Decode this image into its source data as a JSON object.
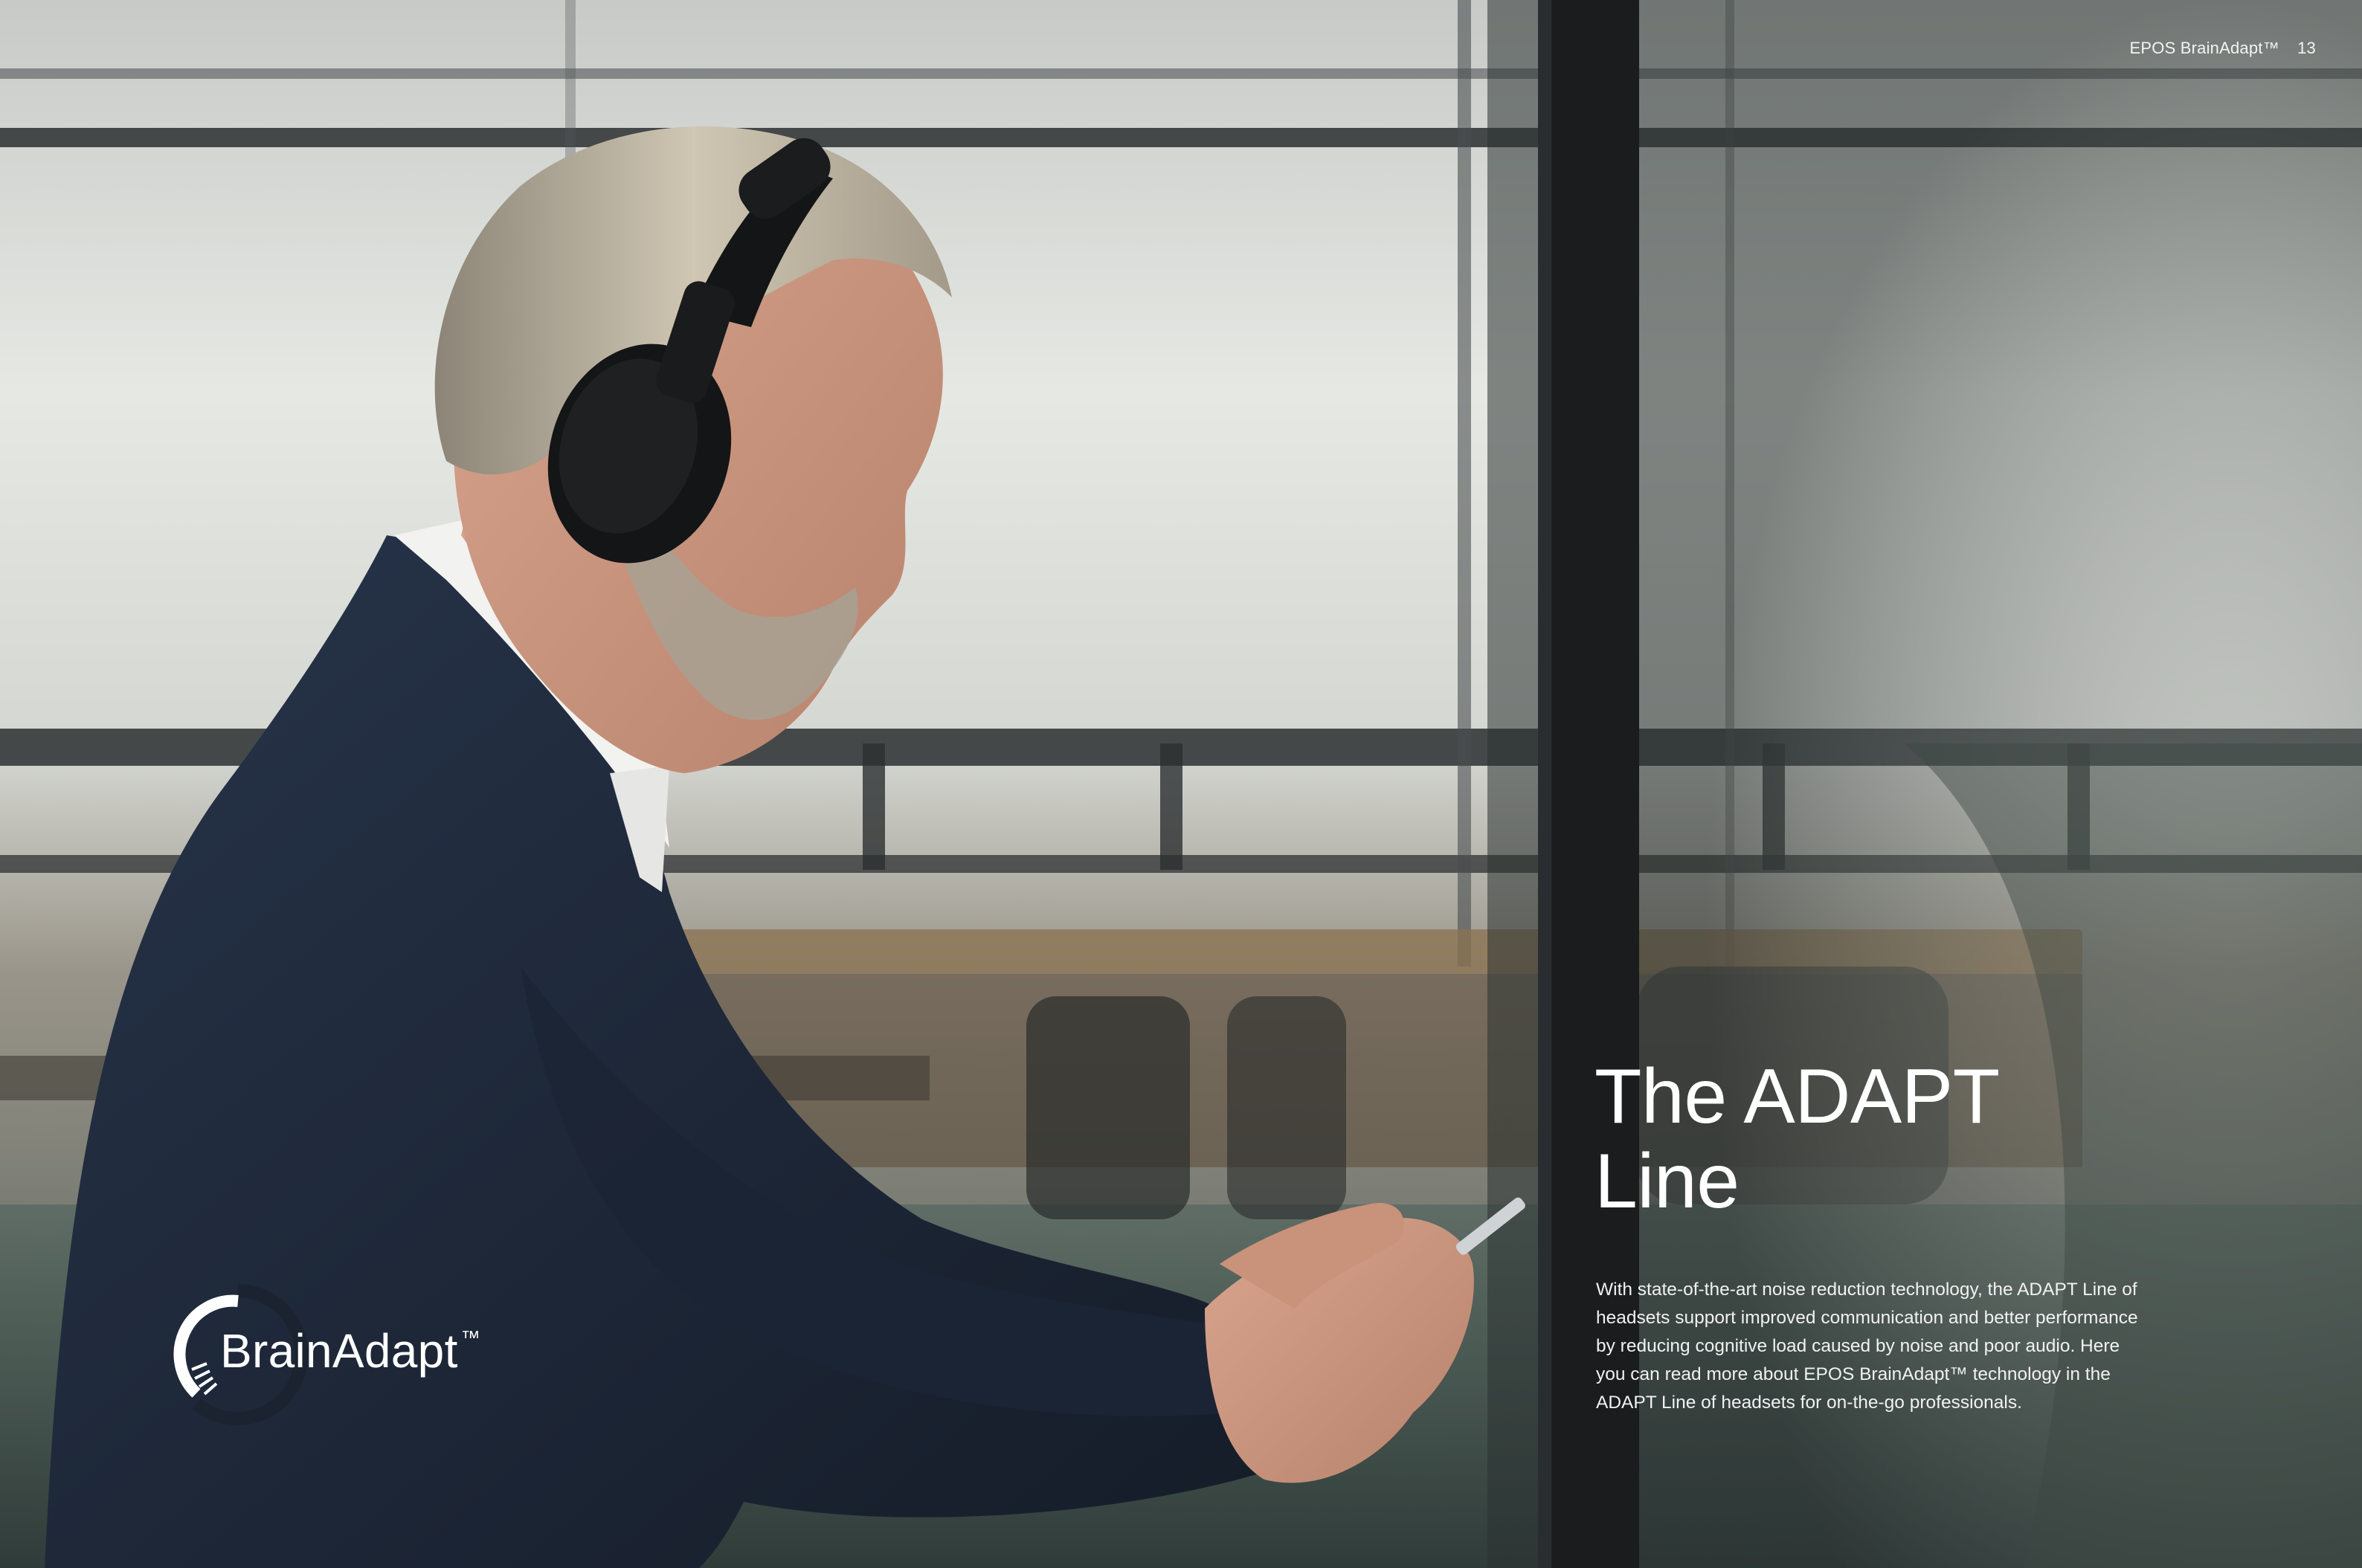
{
  "header": {
    "running_title": "EPOS BrainAdapt™",
    "page_number": "13"
  },
  "main": {
    "headline_line1": "The ADAPT",
    "headline_line2": "Line",
    "body": "With state-of-the-art noise reduction technology, the ADAPT Line of headsets support improved communication and better performance by reducing cognitive load caused by noise and poor audio. Here you can read more about EPOS BrainAdapt™ technology in the ADAPT Line of headsets for on-the-go professionals."
  },
  "logo": {
    "wordmark": "BrainAdapt",
    "trademark": "™"
  },
  "photo": {
    "subject": "man-with-headphones-icon"
  },
  "colors": {
    "text": "#ffffff",
    "jacket": "#1f2a3a",
    "pillar": "#1a1c1e",
    "headphones": "#141516"
  }
}
